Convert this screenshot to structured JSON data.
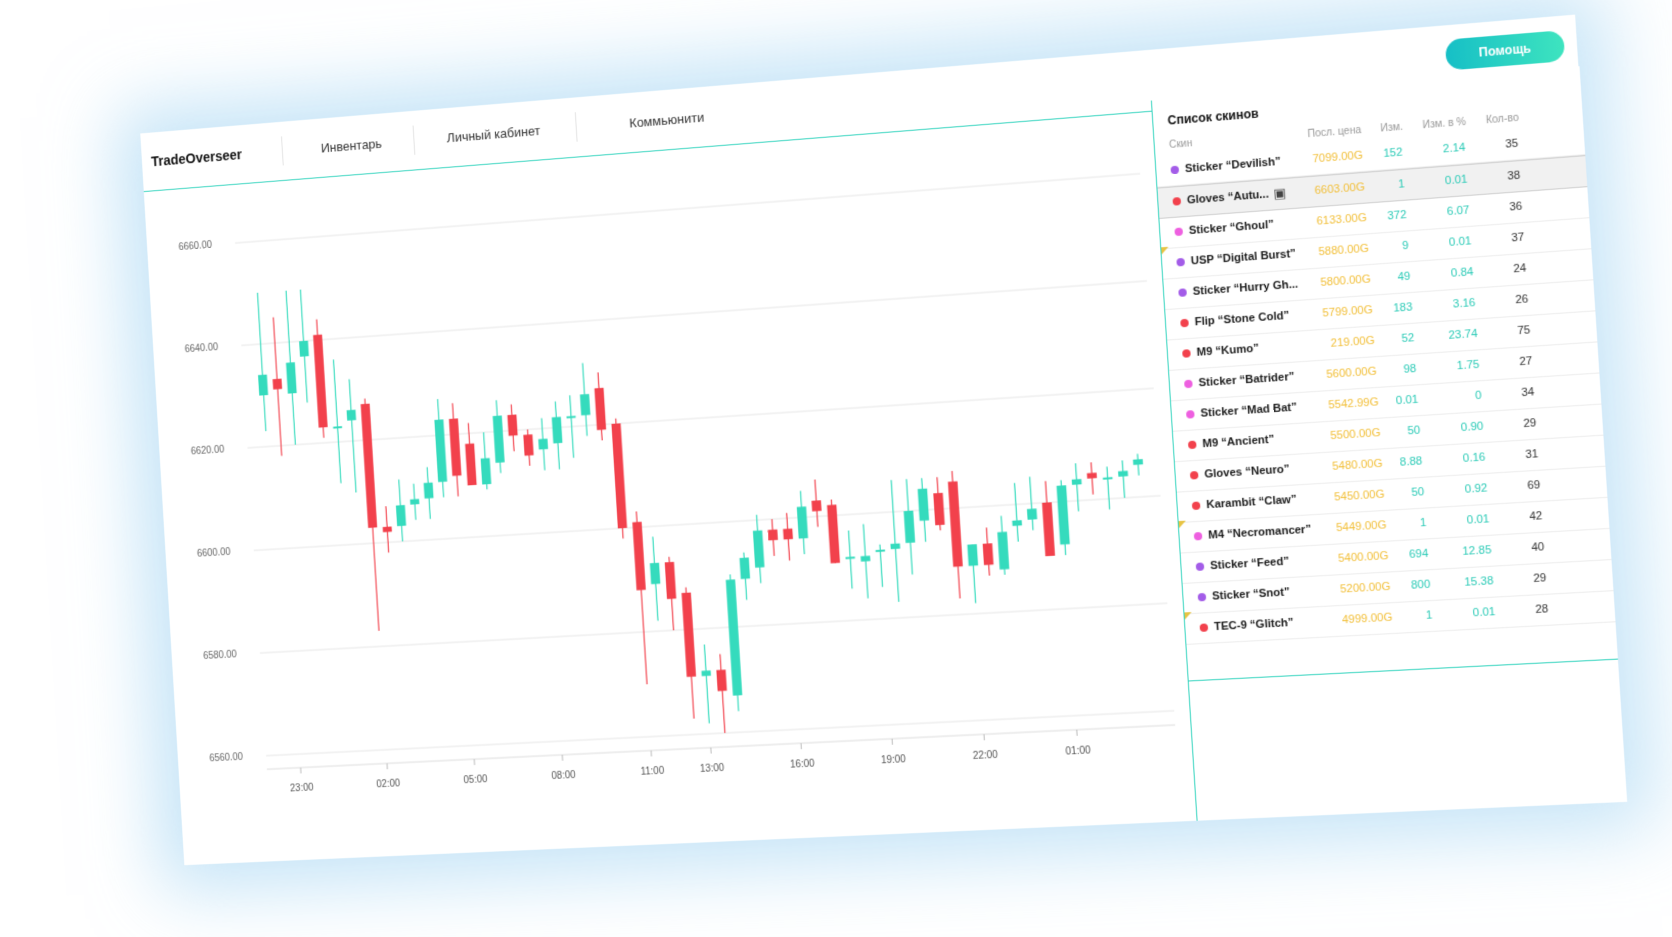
{
  "header": {
    "brand": "TradeOverseer",
    "nav": [
      "Инвентарь",
      "Личный кабинет",
      "Коммьюнити"
    ],
    "help_label": "Помощь"
  },
  "colors": {
    "accent": "#39d5c0",
    "up": "#35dbbd",
    "down": "#f2414c",
    "price": "#f2bf38"
  },
  "chart_data": {
    "type": "candlestick",
    "y_ticks": [
      "6660.00",
      "6640.00",
      "6620.00",
      "6600.00",
      "6580.00",
      "6560.00"
    ],
    "ylim": [
      6560,
      6660
    ],
    "x_ticks": [
      "23:00",
      "02:00",
      "05:00",
      "08:00",
      "11:00",
      "13:00",
      "16:00",
      "19:00",
      "22:00",
      "01:00"
    ],
    "x_tick_index": [
      1,
      7,
      13,
      19,
      25,
      29,
      35,
      41,
      47,
      53
    ],
    "candles": [
      {
        "o": 6630,
        "h": 6650,
        "l": 6623,
        "c": 6634
      },
      {
        "o": 6633,
        "h": 6645,
        "l": 6618,
        "c": 6631
      },
      {
        "o": 6630,
        "h": 6650,
        "l": 6620,
        "c": 6636
      },
      {
        "o": 6637,
        "h": 6650,
        "l": 6628,
        "c": 6640
      },
      {
        "o": 6641,
        "h": 6644,
        "l": 6621,
        "c": 6623
      },
      {
        "o": 6623,
        "h": 6636,
        "l": 6612,
        "c": 6623
      },
      {
        "o": 6624,
        "h": 6632,
        "l": 6610,
        "c": 6626
      },
      {
        "o": 6627,
        "h": 6628,
        "l": 6583,
        "c": 6603
      },
      {
        "o": 6603,
        "h": 6607,
        "l": 6598,
        "c": 6602
      },
      {
        "o": 6603,
        "h": 6612,
        "l": 6600,
        "c": 6607
      },
      {
        "o": 6607,
        "h": 6611,
        "l": 6604,
        "c": 6608
      },
      {
        "o": 6608,
        "h": 6614,
        "l": 6604,
        "c": 6611
      },
      {
        "o": 6611,
        "h": 6627,
        "l": 6608,
        "c": 6623
      },
      {
        "o": 6623,
        "h": 6626,
        "l": 6608,
        "c": 6612
      },
      {
        "o": 6618,
        "h": 6622,
        "l": 6610,
        "c": 6610
      },
      {
        "o": 6610,
        "h": 6620,
        "l": 6609,
        "c": 6615
      },
      {
        "o": 6614,
        "h": 6626,
        "l": 6612,
        "c": 6623
      },
      {
        "o": 6623,
        "h": 6625,
        "l": 6616,
        "c": 6619
      },
      {
        "o": 6619,
        "h": 6620,
        "l": 6613,
        "c": 6615
      },
      {
        "o": 6616,
        "h": 6622,
        "l": 6612,
        "c": 6618
      },
      {
        "o": 6617,
        "h": 6625,
        "l": 6612,
        "c": 6622
      },
      {
        "o": 6622,
        "h": 6626,
        "l": 6614,
        "c": 6622
      },
      {
        "o": 6622,
        "h": 6632,
        "l": 6618,
        "c": 6626
      },
      {
        "o": 6627,
        "h": 6630,
        "l": 6617,
        "c": 6619
      },
      {
        "o": 6620,
        "h": 6621,
        "l": 6598,
        "c": 6600
      },
      {
        "o": 6601,
        "h": 6603,
        "l": 6570,
        "c": 6588
      },
      {
        "o": 6589,
        "h": 6598,
        "l": 6582,
        "c": 6593
      },
      {
        "o": 6593,
        "h": 6594,
        "l": 6580,
        "c": 6586
      },
      {
        "o": 6587,
        "h": 6588,
        "l": 6563,
        "c": 6571
      },
      {
        "o": 6571,
        "h": 6577,
        "l": 6562,
        "c": 6572
      },
      {
        "o": 6572,
        "h": 6575,
        "l": 6560,
        "c": 6568
      },
      {
        "o": 6567,
        "h": 6590,
        "l": 6564,
        "c": 6589
      },
      {
        "o": 6589,
        "h": 6594,
        "l": 6585,
        "c": 6593
      },
      {
        "o": 6591,
        "h": 6601,
        "l": 6588,
        "c": 6598
      },
      {
        "o": 6598,
        "h": 6600,
        "l": 6593,
        "c": 6596
      },
      {
        "o": 6598,
        "h": 6601,
        "l": 6592,
        "c": 6596
      },
      {
        "o": 6596,
        "h": 6605,
        "l": 6593,
        "c": 6602
      },
      {
        "o": 6603,
        "h": 6607,
        "l": 6598,
        "c": 6601
      },
      {
        "o": 6602,
        "h": 6603,
        "l": 6591,
        "c": 6591
      },
      {
        "o": 6592,
        "h": 6597,
        "l": 6586,
        "c": 6592
      },
      {
        "o": 6591,
        "h": 6598,
        "l": 6584,
        "c": 6592
      },
      {
        "o": 6593,
        "h": 6594,
        "l": 6586,
        "c": 6593
      },
      {
        "o": 6593,
        "h": 6606,
        "l": 6583,
        "c": 6594
      },
      {
        "o": 6594,
        "h": 6606,
        "l": 6588,
        "c": 6600
      },
      {
        "o": 6598,
        "h": 6606,
        "l": 6594,
        "c": 6604
      },
      {
        "o": 6603,
        "h": 6606,
        "l": 6596,
        "c": 6597
      },
      {
        "o": 6605,
        "h": 6607,
        "l": 6583,
        "c": 6589
      },
      {
        "o": 6589,
        "h": 6593,
        "l": 6582,
        "c": 6593
      },
      {
        "o": 6593,
        "h": 6596,
        "l": 6587,
        "c": 6589
      },
      {
        "o": 6588,
        "h": 6598,
        "l": 6587,
        "c": 6595
      },
      {
        "o": 6596,
        "h": 6604,
        "l": 6593,
        "c": 6597
      },
      {
        "o": 6597,
        "h": 6605,
        "l": 6595,
        "c": 6599
      },
      {
        "o": 6600,
        "h": 6604,
        "l": 6592,
        "c": 6590
      },
      {
        "o": 6592,
        "h": 6604,
        "l": 6590,
        "c": 6603
      },
      {
        "o": 6603,
        "h": 6607,
        "l": 6598,
        "c": 6604
      },
      {
        "o": 6605,
        "h": 6607,
        "l": 6601,
        "c": 6604
      },
      {
        "o": 6604,
        "h": 6606,
        "l": 6598,
        "c": 6604
      },
      {
        "o": 6604,
        "h": 6607,
        "l": 6600,
        "c": 6605
      },
      {
        "o": 6606,
        "h": 6608,
        "l": 6604,
        "c": 6607
      }
    ]
  },
  "skins": {
    "title": "Список скинов",
    "columns": [
      "Скин",
      "Посл. цена",
      "Изм.",
      "Изм. в %",
      "Кол-во"
    ],
    "rows": [
      {
        "name": "Sticker “Devilish”",
        "price": "7099.00G",
        "change": "152",
        "pct": "2.14",
        "qty": "35",
        "dot": "#a35ce8",
        "flag": false,
        "pin": false,
        "selected": false
      },
      {
        "name": "Gloves “Autu...",
        "price": "6603.00G",
        "change": "1",
        "pct": "0.01",
        "qty": "38",
        "dot": "#f2414c",
        "flag": false,
        "pin": true,
        "selected": true
      },
      {
        "name": "Sticker “Ghoul”",
        "price": "6133.00G",
        "change": "372",
        "pct": "6.07",
        "qty": "36",
        "dot": "#ee5fe0",
        "flag": false,
        "pin": false,
        "selected": false
      },
      {
        "name": "USP “Digital Burst”",
        "price": "5880.00G",
        "change": "9",
        "pct": "0.01",
        "qty": "37",
        "dot": "#a35ce8",
        "flag": true,
        "pin": false,
        "selected": false
      },
      {
        "name": "Sticker “Hurry Gh...",
        "price": "5800.00G",
        "change": "49",
        "pct": "0.84",
        "qty": "24",
        "dot": "#a35ce8",
        "flag": false,
        "pin": false,
        "selected": false
      },
      {
        "name": "Flip “Stone Cold”",
        "price": "5799.00G",
        "change": "183",
        "pct": "3.16",
        "qty": "26",
        "dot": "#f2414c",
        "flag": false,
        "pin": false,
        "selected": false
      },
      {
        "name": "M9 “Kumo”",
        "price": "219.00G",
        "change": "52",
        "pct": "23.74",
        "qty": "75",
        "dot": "#f2414c",
        "flag": false,
        "pin": false,
        "selected": false
      },
      {
        "name": "Sticker “Batrider”",
        "price": "5600.00G",
        "change": "98",
        "pct": "1.75",
        "qty": "27",
        "dot": "#ee5fe0",
        "flag": false,
        "pin": false,
        "selected": false
      },
      {
        "name": "Sticker “Mad Bat”",
        "price": "5542.99G",
        "change": "0.01",
        "pct": "0",
        "qty": "34",
        "dot": "#ee5fe0",
        "flag": false,
        "pin": false,
        "selected": false
      },
      {
        "name": "M9 “Ancient”",
        "price": "5500.00G",
        "change": "50",
        "pct": "0.90",
        "qty": "29",
        "dot": "#f2414c",
        "flag": false,
        "pin": false,
        "selected": false
      },
      {
        "name": "Gloves “Neuro”",
        "price": "5480.00G",
        "change": "8.88",
        "pct": "0.16",
        "qty": "31",
        "dot": "#f2414c",
        "flag": false,
        "pin": false,
        "selected": false
      },
      {
        "name": "Karambit “Claw”",
        "price": "5450.00G",
        "change": "50",
        "pct": "0.92",
        "qty": "69",
        "dot": "#f2414c",
        "flag": false,
        "pin": false,
        "selected": false
      },
      {
        "name": "M4 “Necromancer”",
        "price": "5449.00G",
        "change": "1",
        "pct": "0.01",
        "qty": "42",
        "dot": "#ee5fe0",
        "flag": true,
        "pin": false,
        "selected": false
      },
      {
        "name": "Sticker “Feed”",
        "price": "5400.00G",
        "change": "694",
        "pct": "12.85",
        "qty": "40",
        "dot": "#a35ce8",
        "flag": false,
        "pin": false,
        "selected": false
      },
      {
        "name": "Sticker “Snot”",
        "price": "5200.00G",
        "change": "800",
        "pct": "15.38",
        "qty": "29",
        "dot": "#a35ce8",
        "flag": false,
        "pin": false,
        "selected": false
      },
      {
        "name": "TEC-9 “Glitch”",
        "price": "4999.00G",
        "change": "1",
        "pct": "0.01",
        "qty": "28",
        "dot": "#f2414c",
        "flag": true,
        "pin": false,
        "selected": false
      }
    ]
  }
}
